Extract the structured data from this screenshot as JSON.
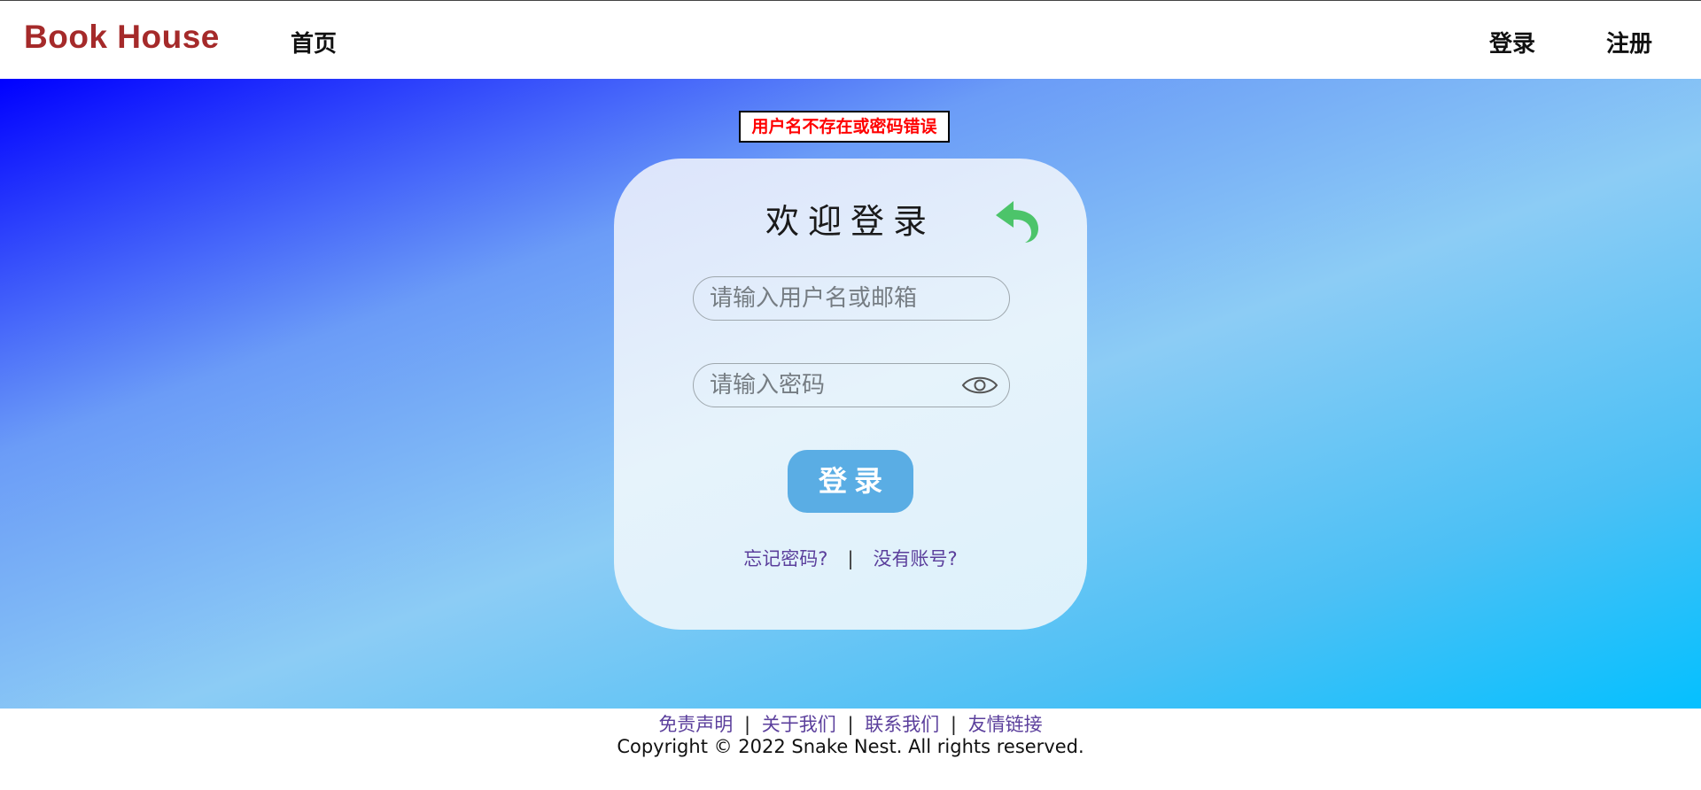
{
  "header": {
    "logo": "Book House",
    "nav_home": "首页",
    "nav_login": "登录",
    "nav_register": "注册"
  },
  "error_message": "用户名不存在或密码错误",
  "login_card": {
    "title": "欢迎登录",
    "back_icon": "back-arrow-icon",
    "username_placeholder": "请输入用户名或邮箱",
    "password_placeholder": "请输入密码",
    "eye_icon": "eye-icon",
    "login_button": "登录",
    "forgot_password": "忘记密码?",
    "link_separator": "|",
    "no_account": "没有账号?"
  },
  "footer": {
    "links": [
      "免责声明",
      "关于我们",
      "联系我们",
      "友情链接"
    ],
    "separator": "|",
    "copyright": "Copyright © 2022 Snake Nest. All rights reserved."
  },
  "colors": {
    "logo": "#a52a2a",
    "error_text": "#ff0000",
    "link": "#5b3f9c",
    "login_button_bg": "#5aade4",
    "back_icon": "#4cc46a"
  }
}
